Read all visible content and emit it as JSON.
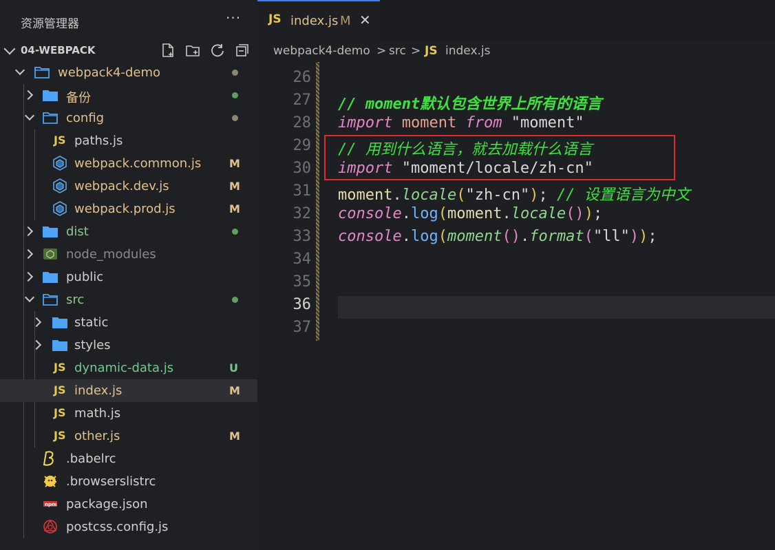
{
  "explorer": {
    "title": "资源管理器",
    "more": "···",
    "project": "04-WEBPACK"
  },
  "tree": [
    {
      "name": "webpack4-demo",
      "kind": "folder",
      "open": true,
      "depth": 0,
      "status": "dot-gray"
    },
    {
      "name": "备份",
      "kind": "folder",
      "open": false,
      "depth": 1,
      "status": "dot-green"
    },
    {
      "name": "config",
      "kind": "folder",
      "open": true,
      "depth": 1,
      "status": "dot-gray"
    },
    {
      "name": "paths.js",
      "kind": "js",
      "depth": 2,
      "status": ""
    },
    {
      "name": "webpack.common.js",
      "kind": "webpack",
      "depth": 2,
      "status": "M"
    },
    {
      "name": "webpack.dev.js",
      "kind": "webpack",
      "depth": 2,
      "status": "M"
    },
    {
      "name": "webpack.prod.js",
      "kind": "webpack",
      "depth": 2,
      "status": "M"
    },
    {
      "name": "dist",
      "kind": "folder",
      "open": false,
      "depth": 1,
      "status": "dot-green"
    },
    {
      "name": "node_modules",
      "kind": "node",
      "open": false,
      "depth": 1,
      "status": ""
    },
    {
      "name": "public",
      "kind": "folder",
      "open": false,
      "depth": 1,
      "status": ""
    },
    {
      "name": "src",
      "kind": "folder",
      "open": true,
      "depth": 1,
      "status": "dot-green"
    },
    {
      "name": "static",
      "kind": "folder",
      "open": false,
      "depth": 2,
      "status": ""
    },
    {
      "name": "styles",
      "kind": "folder",
      "open": false,
      "depth": 2,
      "status": ""
    },
    {
      "name": "dynamic-data.js",
      "kind": "js",
      "depth": 2,
      "status": "U"
    },
    {
      "name": "index.js",
      "kind": "js",
      "depth": 2,
      "status": "M",
      "selected": true
    },
    {
      "name": "math.js",
      "kind": "js",
      "depth": 2,
      "status": ""
    },
    {
      "name": "other.js",
      "kind": "js",
      "depth": 2,
      "status": "M"
    },
    {
      "name": ".babelrc",
      "kind": "babel",
      "depth": 1,
      "status": ""
    },
    {
      "name": ".browserslistrc",
      "kind": "browsers",
      "depth": 1,
      "status": ""
    },
    {
      "name": "package.json",
      "kind": "npm",
      "depth": 1,
      "status": ""
    },
    {
      "name": "postcss.config.js",
      "kind": "postcss",
      "depth": 1,
      "status": ""
    }
  ],
  "tab": {
    "icon": "JS",
    "name": "index.js",
    "status": "M",
    "close": "✕"
  },
  "breadcrumb": {
    "project": "webpack4-demo",
    "sep": ">",
    "folder": "src",
    "icon": "JS",
    "file": "index.js"
  },
  "editor": {
    "lines": [
      "26",
      "27",
      "28",
      "29",
      "30",
      "31",
      "32",
      "33",
      "34",
      "35",
      "36",
      "37"
    ],
    "current_line": "36",
    "code": {
      "l27_cm": "// moment默认包含世界上所有的语言",
      "l28_import": "import",
      "l28_id": "moment",
      "l28_from": "from",
      "l28_str": "\"moment\"",
      "l29_cm": "// 用到什么语言，就去加载什么语言",
      "l30_import": "import",
      "l30_str": "\"moment/locale/zh-cn\"",
      "l31_a": "moment",
      "l31_b": "locale",
      "l31_str": "\"zh-cn\"",
      "l31_cm": "// 设置语言为中文",
      "l32_a": "console",
      "l32_b": "log",
      "l32_c": "moment",
      "l32_d": "locale",
      "l33_a": "console",
      "l33_b": "log",
      "l33_c": "moment",
      "l33_d": "format",
      "l33_str": "\"ll\""
    }
  },
  "colors": {
    "accent": "#3c7ff0",
    "modified": "#e2c08d",
    "untracked": "#73c991",
    "highlight_box": "#e02b2b"
  }
}
